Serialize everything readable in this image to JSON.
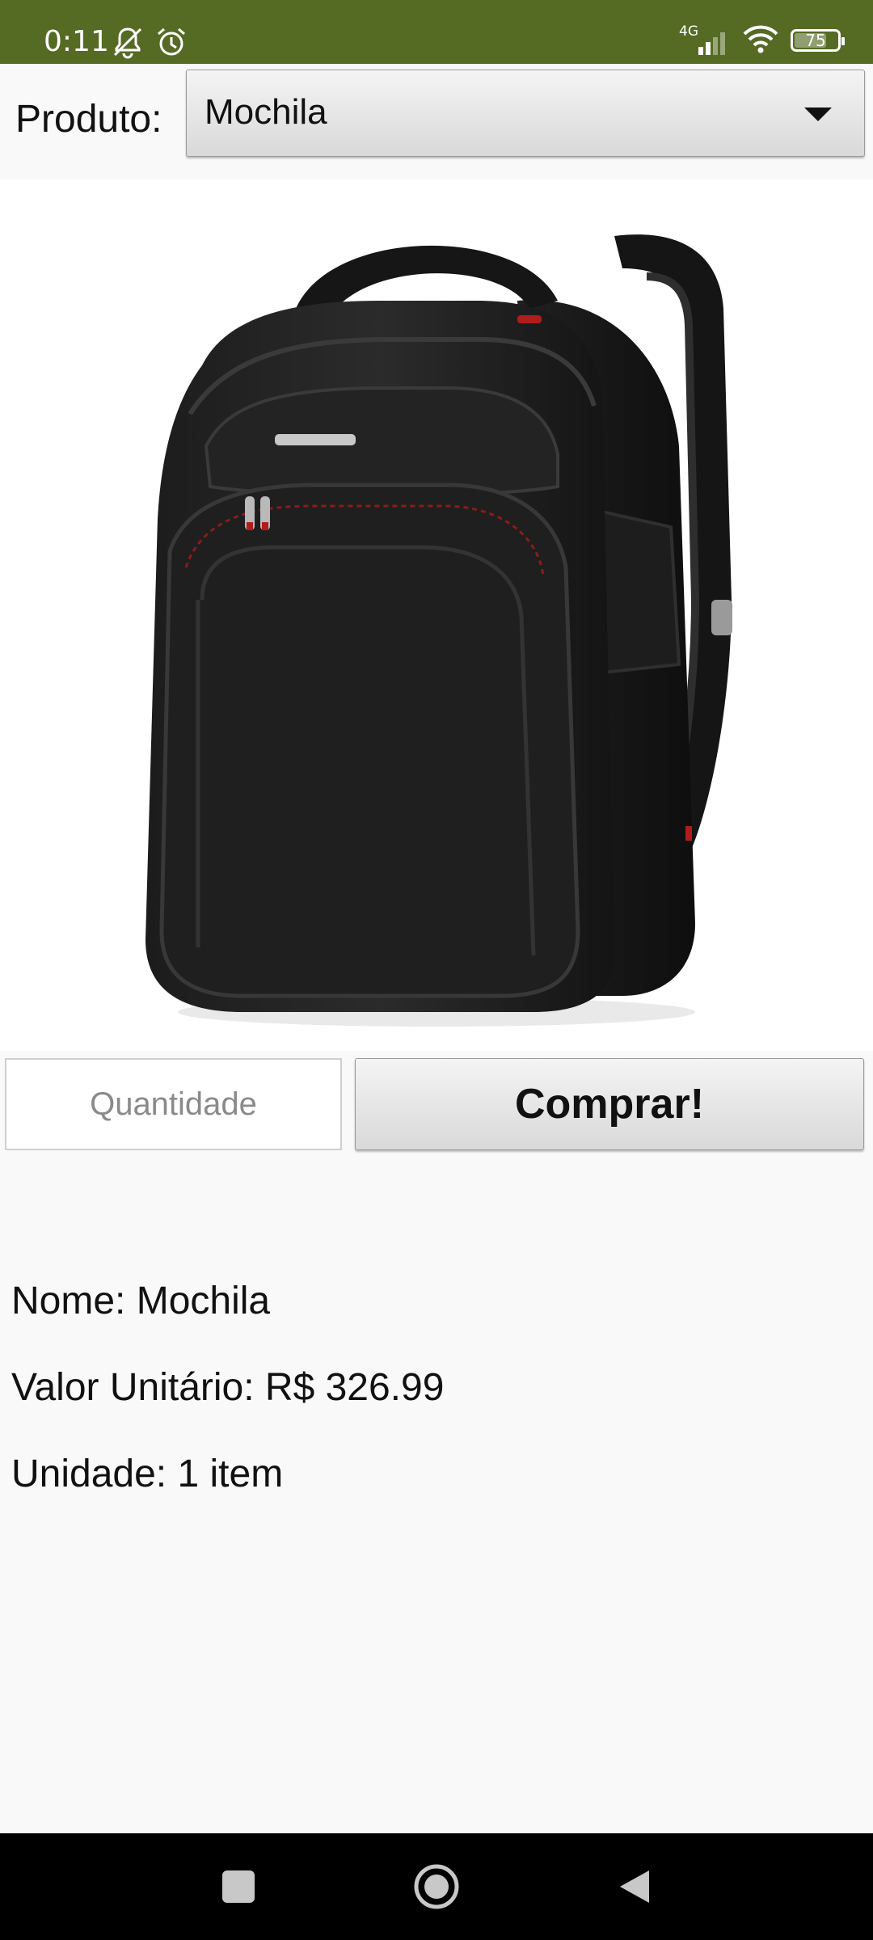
{
  "status_bar": {
    "time": "0:11",
    "network": "4G",
    "battery": "75",
    "battery_level": 0.75,
    "icons": [
      "notifications-muted-icon",
      "alarm-icon",
      "signal-icon",
      "wifi-icon",
      "battery-icon"
    ]
  },
  "form": {
    "produto_label": "Produto:",
    "selected_product": "Mochila",
    "quantity_placeholder": "Quantidade",
    "quantity_value": "",
    "buy_label": "Comprar!"
  },
  "product_image": {
    "icon": "backpack-image"
  },
  "info": {
    "nome": "Nome: Mochila",
    "valor": "Valor Unitário: R$ 326.99",
    "unidade": "Unidade: 1 item"
  },
  "nav": {
    "icons": [
      "recents-square-icon",
      "home-circle-icon",
      "back-triangle-icon"
    ]
  },
  "colors": {
    "status_bar": "#556b24",
    "background": "#f9f9f9",
    "nav_bar": "#000000"
  }
}
